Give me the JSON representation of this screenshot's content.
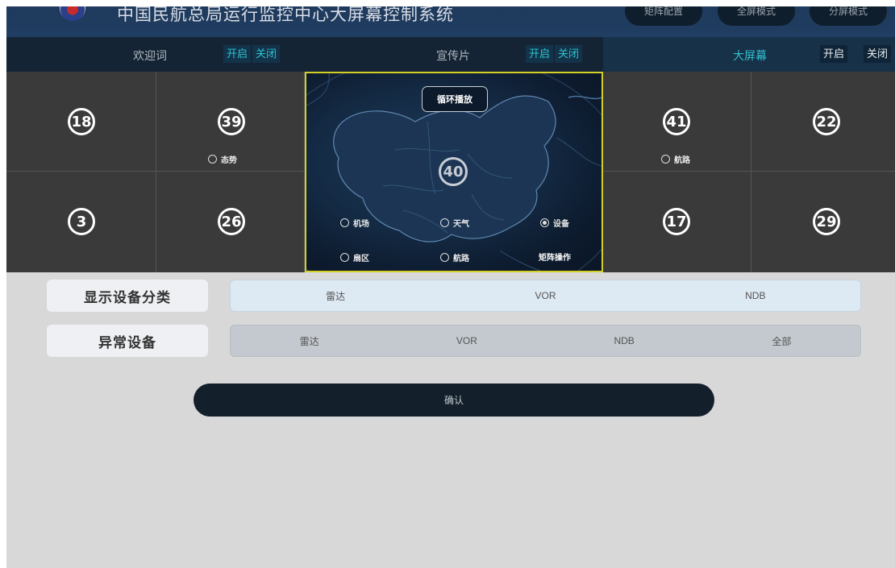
{
  "header": {
    "title": "中国民航总局运行监控中心大屏幕控制系统",
    "buttons": [
      "矩阵配置",
      "全屏模式",
      "分屏模式"
    ]
  },
  "channels": [
    {
      "name": "欢迎词",
      "on": "开启",
      "off": "关闭"
    },
    {
      "name": "宣传片",
      "on": "开启",
      "off": "关闭"
    },
    {
      "name": "大屏幕",
      "on": "开启",
      "off": "关闭"
    }
  ],
  "wall": {
    "left_cells": [
      "18",
      "39",
      "3",
      "26"
    ],
    "right_cells": [
      "41",
      "22",
      "17",
      "29"
    ],
    "left_radio": "态势",
    "right_radio": "航路"
  },
  "map_panel": {
    "loop_label": "循环播放",
    "number": "40",
    "options": [
      {
        "label": "机场",
        "selected": false
      },
      {
        "label": "天气",
        "selected": false
      },
      {
        "label": "设备",
        "selected": true
      },
      {
        "label": "扇区",
        "selected": false
      },
      {
        "label": "航路",
        "selected": false
      }
    ],
    "matrix_label": "矩阵操作",
    "highlight_color": "#d4cf26"
  },
  "device_category": {
    "label": "显示设备分类",
    "options": [
      "雷达",
      "VOR",
      "NDB"
    ]
  },
  "abnormal_device": {
    "label": "异常设备",
    "options": [
      "雷达",
      "VOR",
      "NDB",
      "全部"
    ]
  },
  "confirm_label": "确认"
}
